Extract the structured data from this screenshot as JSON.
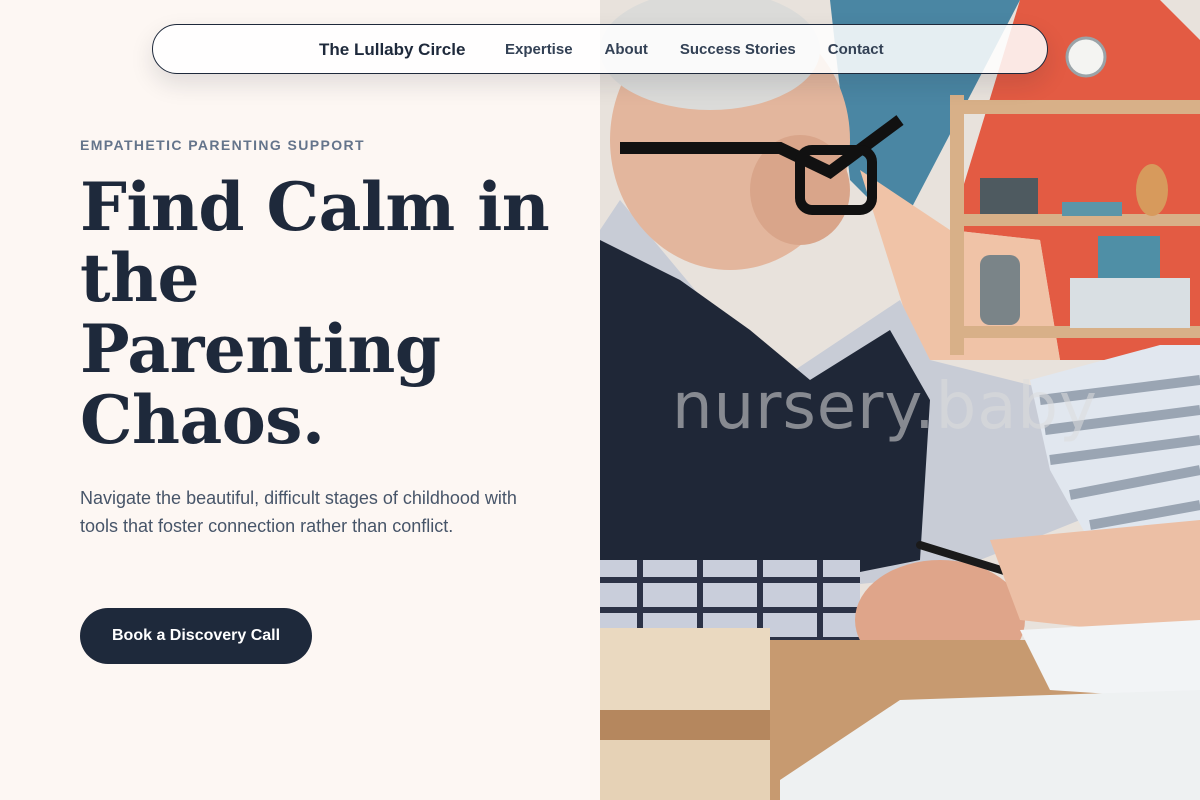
{
  "nav": {
    "brand": "The Lullaby Circle",
    "links": [
      "Expertise",
      "About",
      "Success Stories",
      "Contact"
    ]
  },
  "hero": {
    "eyebrow": "EMPATHETIC PARENTING SUPPORT",
    "headline": "Find Calm in the Parenting Chaos.",
    "subtext": "Navigate the beautiful, difficult stages of childhood with tools that foster connection rather than conflict.",
    "cta_label": "Book a Discovery Call"
  },
  "photo": {
    "watermark": "nursery.baby"
  },
  "colors": {
    "background": "#fdf7f3",
    "primary": "#1e293b",
    "muted": "#64748b",
    "body_text": "#475569"
  }
}
